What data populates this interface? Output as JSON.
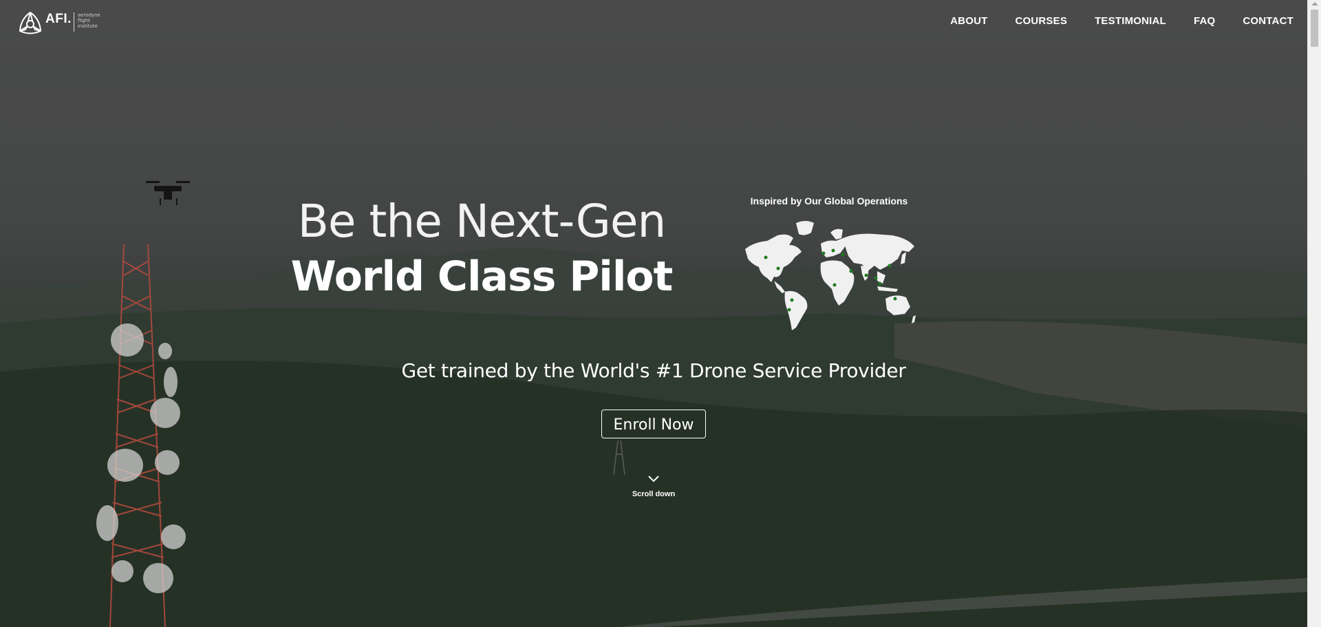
{
  "brand": {
    "logo_text": "AFI.",
    "sub_line_1": "aerodyne",
    "sub_line_2": "flight",
    "sub_line_3": "institute"
  },
  "nav": {
    "items": [
      {
        "label": "ABOUT"
      },
      {
        "label": "COURSES"
      },
      {
        "label": "TESTIMONIAL"
      },
      {
        "label": "FAQ"
      },
      {
        "label": "CONTACT"
      }
    ]
  },
  "hero": {
    "headline_line1": "Be the Next-Gen",
    "headline_line2": "World Class Pilot",
    "map_title": "Inspired by Our Global Operations",
    "subheadline": "Get trained by the World's #1 Drone Service Provider",
    "cta_label": "Enroll Now",
    "scroll_label": "Scroll down"
  },
  "colors": {
    "text": "#ffffff",
    "map_fill": "#f0f0f0",
    "map_marker": "#1f7a1f",
    "overlay": "#3a3d3b"
  }
}
